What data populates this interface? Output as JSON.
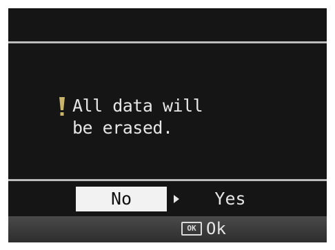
{
  "dialog": {
    "message_line1": "All data will",
    "message_line2": "be erased.",
    "warning_icon": "exclamation-icon"
  },
  "options": {
    "no_label": "No",
    "yes_label": "Yes",
    "selected": "No"
  },
  "footer": {
    "ok_key_label": "OK",
    "ok_action_label": "Ok"
  },
  "colors": {
    "background": "#151515",
    "highlight": "#f2f2f2",
    "warning": "#c8b46a",
    "text": "#e6e6e6"
  }
}
